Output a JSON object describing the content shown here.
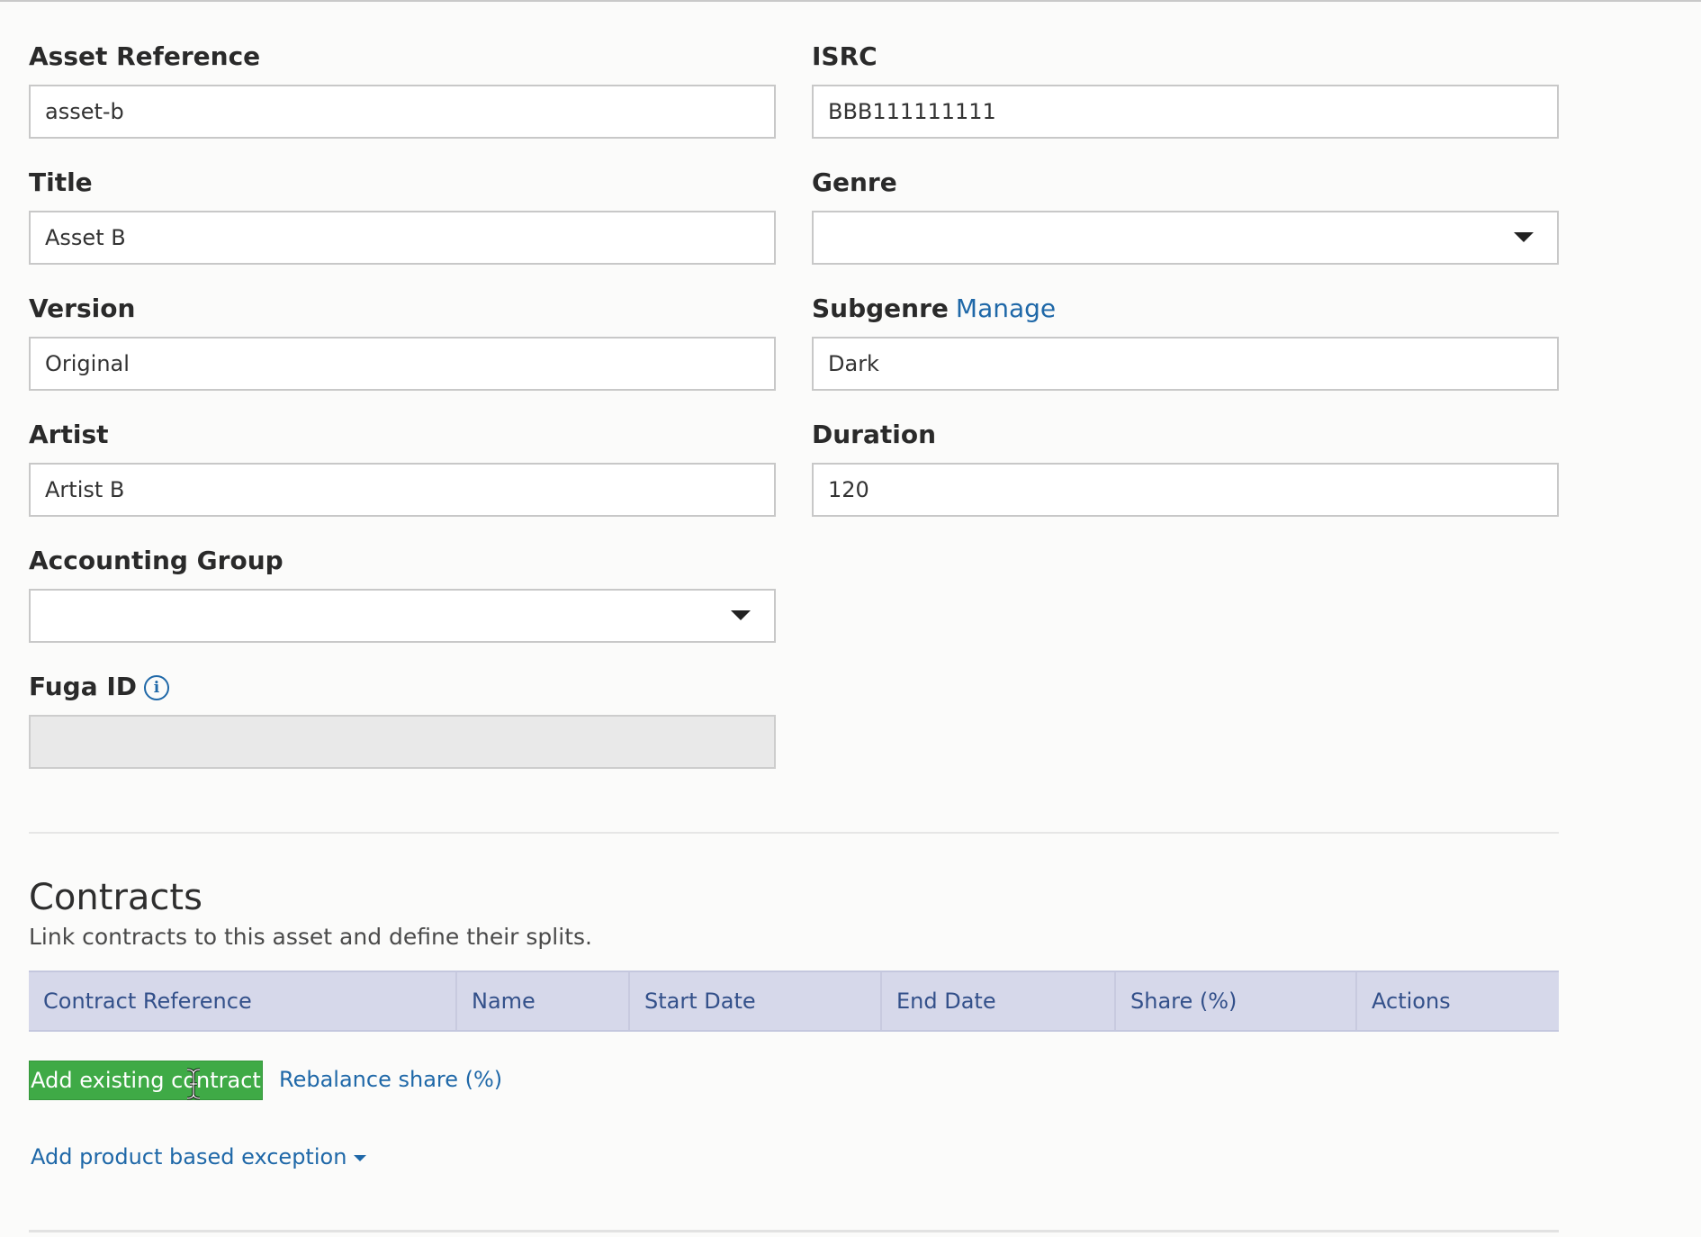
{
  "fields": {
    "asset_reference": {
      "label": "Asset Reference",
      "value": "asset-b"
    },
    "isrc": {
      "label": "ISRC",
      "value": "BBB111111111"
    },
    "title": {
      "label": "Title",
      "value": "Asset B"
    },
    "genre": {
      "label": "Genre",
      "value": ""
    },
    "version": {
      "label": "Version",
      "value": "Original"
    },
    "subgenre": {
      "label": "Subgenre",
      "manage_link": "Manage",
      "value": "Dark"
    },
    "artist": {
      "label": "Artist",
      "value": "Artist B"
    },
    "duration": {
      "label": "Duration",
      "value": "120"
    },
    "accounting_group": {
      "label": "Accounting Group",
      "value": ""
    },
    "fuga_id": {
      "label": "Fuga ID",
      "value": "",
      "info_icon": "info-icon"
    }
  },
  "contracts": {
    "title": "Contracts",
    "description": "Link contracts to this asset and define their splits.",
    "columns": [
      "Contract Reference",
      "Name",
      "Start Date",
      "End Date",
      "Share (%)",
      "Actions"
    ],
    "add_button": "Add existing contract",
    "rebalance_link": "Rebalance share (%)",
    "exception_link": "Add product based exception"
  },
  "colors": {
    "link": "#1f68a8",
    "button_green": "#3faa46",
    "table_header_bg": "#d6d8ea",
    "table_header_text": "#33508a"
  }
}
